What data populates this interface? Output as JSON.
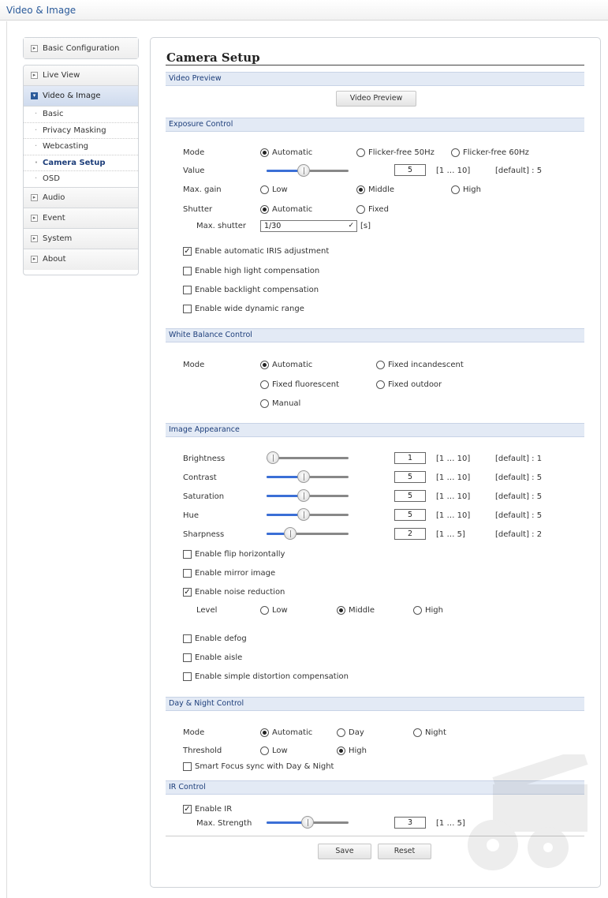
{
  "page": {
    "title": "Video & Image"
  },
  "sidebar": {
    "basic_config": "Basic Configuration",
    "live_view": "Live View",
    "video_image": "Video & Image",
    "subitems": [
      "Basic",
      "Privacy Masking",
      "Webcasting",
      "Camera Setup",
      "OSD"
    ],
    "audio": "Audio",
    "event": "Event",
    "system": "System",
    "about": "About"
  },
  "main": {
    "title": "Camera Setup",
    "video_preview": {
      "header": "Video Preview",
      "button": "Video Preview"
    },
    "exposure": {
      "header": "Exposure Control",
      "mode_label": "Mode",
      "mode_options": [
        "Automatic",
        "Flicker-free 50Hz",
        "Flicker-free 60Hz"
      ],
      "mode_selected": "Automatic",
      "value_label": "Value",
      "value": {
        "value": "5",
        "range": "[1 … 10]",
        "default": "[default] : 5",
        "level": 5,
        "min": 1,
        "max": 10
      },
      "maxgain_label": "Max. gain",
      "maxgain_options": [
        "Low",
        "Middle",
        "High"
      ],
      "maxgain_selected": "Middle",
      "shutter_label": "Shutter",
      "shutter_options": [
        "Automatic",
        "Fixed"
      ],
      "shutter_selected": "Automatic",
      "maxshutter_label": "Max. shutter",
      "maxshutter_value": "1/30",
      "maxshutter_unit": "[s]",
      "checks": [
        {
          "label": "Enable automatic IRIS adjustment",
          "checked": true
        },
        {
          "label": "Enable high light compensation",
          "checked": false
        },
        {
          "label": "Enable backlight compensation",
          "checked": false
        },
        {
          "label": "Enable wide dynamic range",
          "checked": false
        }
      ]
    },
    "white_balance": {
      "header": "White Balance Control",
      "mode_label": "Mode",
      "options": [
        "Automatic",
        "Fixed incandescent",
        "Fixed fluorescent",
        "Fixed outdoor",
        "Manual"
      ],
      "selected": "Automatic"
    },
    "image_appearance": {
      "header": "Image Appearance",
      "sliders": [
        {
          "label": "Brightness",
          "value": "1",
          "range": "[1 … 10]",
          "default": "[default] : 1",
          "level": 1,
          "min": 1,
          "max": 10
        },
        {
          "label": "Contrast",
          "value": "5",
          "range": "[1 … 10]",
          "default": "[default] : 5",
          "level": 5,
          "min": 1,
          "max": 10
        },
        {
          "label": "Saturation",
          "value": "5",
          "range": "[1 … 10]",
          "default": "[default] : 5",
          "level": 5,
          "min": 1,
          "max": 10
        },
        {
          "label": "Hue",
          "value": "5",
          "range": "[1 … 10]",
          "default": "[default] : 5",
          "level": 5,
          "min": 1,
          "max": 10
        },
        {
          "label": "Sharpness",
          "value": "2",
          "range": "[1 … 5]",
          "default": "[default] : 2",
          "level": 2,
          "min": 1,
          "max": 5
        }
      ],
      "checks": [
        {
          "label": "Enable flip horizontally",
          "checked": false
        },
        {
          "label": "Enable mirror image",
          "checked": false
        },
        {
          "label": "Enable noise reduction",
          "checked": true
        },
        {
          "label": "Enable defog",
          "checked": false
        },
        {
          "label": "Enable aisle",
          "checked": false
        },
        {
          "label": "Enable simple distortion compensation",
          "checked": false
        }
      ],
      "level_label": "Level",
      "level_options": [
        "Low",
        "Middle",
        "High"
      ],
      "level_selected": "Middle"
    },
    "day_night": {
      "header": "Day & Night Control",
      "mode_label": "Mode",
      "mode_options": [
        "Automatic",
        "Day",
        "Night"
      ],
      "mode_selected": "Automatic",
      "threshold_label": "Threshold",
      "threshold_options": [
        "Low",
        "High"
      ],
      "threshold_selected": "High",
      "smart_focus": {
        "label": "Smart Focus sync with Day & Night",
        "checked": false
      }
    },
    "ir": {
      "header": "IR Control",
      "enable": {
        "label": "Enable IR",
        "checked": true
      },
      "strength_label": "Max. Strength",
      "strength": {
        "value": "3",
        "range": "[1 … 5]",
        "level": 3,
        "min": 1,
        "max": 5
      }
    },
    "buttons": {
      "save": "Save",
      "reset": "Reset"
    }
  },
  "colors": {
    "accent": "#3b6fd6",
    "header_text": "#1d3e7a",
    "section_bg": "#e3eaf5"
  }
}
